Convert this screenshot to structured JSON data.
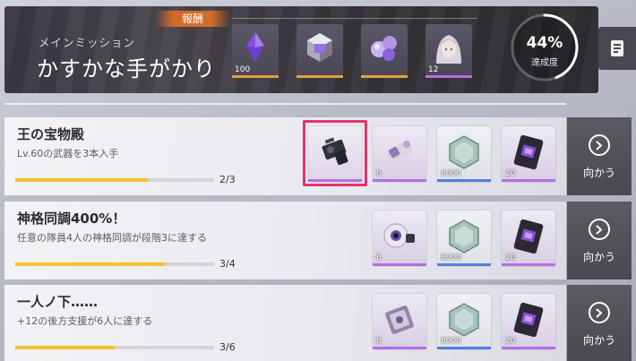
{
  "header": {
    "subtitle": "メインミッション",
    "title": "かすかな手がかり",
    "reward_label": "報酬",
    "rewards": [
      {
        "icon": "crystal-icon",
        "qty": "100",
        "color": "#e0a23c"
      },
      {
        "icon": "cube-icon",
        "qty": "",
        "color": "#e0a23c"
      },
      {
        "icon": "orb-cluster-icon",
        "qty": "",
        "color": "#e0a23c"
      },
      {
        "icon": "character-portrait-icon",
        "qty": "12",
        "color": "#b46fe3"
      }
    ],
    "progress_percent": "44%",
    "progress_value": 0.44,
    "progress_label": "達成度"
  },
  "missions": [
    {
      "title": "王の宝物殿",
      "desc": "Lv.60の武器を3本入手",
      "count": "2/3",
      "progress": 0.667,
      "go_label": "向かう",
      "items": [
        {
          "icon": "weapon-device-icon",
          "qty": "",
          "rarity": "purple",
          "highlighted": true
        },
        {
          "icon": "scroll-capsule-icon",
          "qty": "6",
          "rarity": "purple"
        },
        {
          "icon": "hex-crystal-icon",
          "qty": "8000",
          "rarity": "blue"
        },
        {
          "icon": "purple-chip-icon",
          "qty": "20",
          "rarity": "purple"
        }
      ]
    },
    {
      "title": "神格同調400%！",
      "desc": "任意の隊員4人の神格同調が段階3に達する",
      "count": "3/4",
      "progress": 0.75,
      "go_label": "向かう",
      "items": [
        {
          "icon": "sphere-lens-icon",
          "qty": "6",
          "rarity": "purple"
        },
        {
          "icon": "hex-crystal-icon",
          "qty": "8000",
          "rarity": "blue"
        },
        {
          "icon": "purple-chip-icon",
          "qty": "20",
          "rarity": "purple"
        }
      ]
    },
    {
      "title": "一人ノ下……",
      "desc": "+12の後方支援が6人に達する",
      "count": "3/6",
      "progress": 0.5,
      "go_label": "向かう",
      "items": [
        {
          "icon": "ticket-card-icon",
          "qty": "8",
          "rarity": "purple"
        },
        {
          "icon": "hex-crystal-icon",
          "qty": "8000",
          "rarity": "blue"
        },
        {
          "icon": "purple-chip-icon",
          "qty": "20",
          "rarity": "purple"
        }
      ]
    }
  ]
}
